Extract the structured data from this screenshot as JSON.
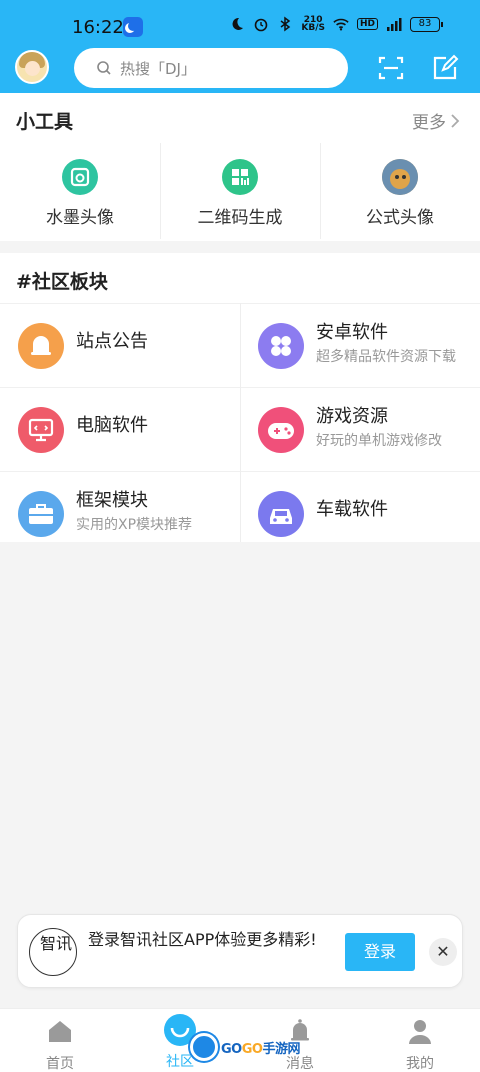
{
  "status_bar": {
    "time": "16:22",
    "net_speed": "210\nKB/S",
    "hd": "HD",
    "battery": "83"
  },
  "header": {
    "search_placeholder": "热搜「DJ」"
  },
  "tools": {
    "title": "小工具",
    "more": "更多",
    "items": [
      {
        "label": "水墨头像",
        "icon": "ink-avatar-icon",
        "color": "#2ec4a0"
      },
      {
        "label": "二维码生成",
        "icon": "qrcode-icon",
        "color": "#2ec48a"
      },
      {
        "label": "公式头像",
        "icon": "formula-avatar-icon",
        "color": "#e0a44a"
      }
    ]
  },
  "community": {
    "title": "#社区板块",
    "items": [
      {
        "name": "站点公告",
        "desc": "",
        "icon": "bell-icon",
        "color": "#f5a04b"
      },
      {
        "name": "安卓软件",
        "desc": "超多精品软件资源下载",
        "icon": "apps-grid-icon",
        "color": "#8c7cf0"
      },
      {
        "name": "电脑软件",
        "desc": "",
        "icon": "monitor-icon",
        "color": "#ef5b6a"
      },
      {
        "name": "游戏资源",
        "desc": "好玩的单机游戏修改",
        "icon": "gamepad-icon",
        "color": "#f0507a"
      },
      {
        "name": "框架模块",
        "desc": "实用的XP模块推荐",
        "icon": "toolbox-icon",
        "color": "#5aa8ec"
      },
      {
        "name": "车载软件",
        "desc": "",
        "icon": "car-icon",
        "color": "#7b79ee"
      }
    ]
  },
  "banner": {
    "logo_text": "智讯",
    "text": "登录智讯社区APP体验更多精彩!",
    "login": "登录",
    "close": "✕"
  },
  "tabbar": {
    "items": [
      {
        "label": "首页",
        "icon": "home-icon",
        "active": false
      },
      {
        "label": "社区",
        "icon": "community-icon",
        "active": true
      },
      {
        "label": "消息",
        "icon": "bell-icon",
        "active": false
      },
      {
        "label": "我的",
        "icon": "user-icon",
        "active": false
      }
    ]
  },
  "watermark": {
    "text_blue": "GO",
    "text_gold": "GO",
    "text_site": "手游网"
  },
  "colors": {
    "accent": "#29b6f6"
  }
}
